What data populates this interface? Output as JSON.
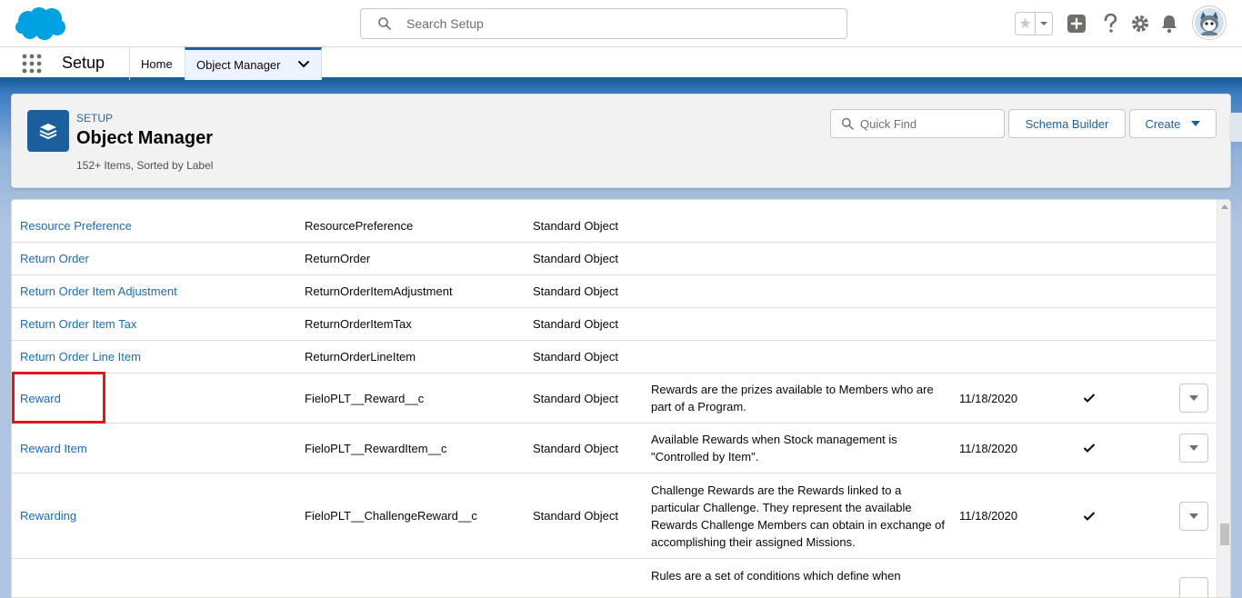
{
  "header": {
    "logo_icon": "salesforce-cloud-logo",
    "search_placeholder": "Search Setup",
    "icons": [
      "favorites-star-icon",
      "favorites-dropdown-icon",
      "global-actions-plus-icon",
      "help-question-icon",
      "setup-gear-icon",
      "notifications-bell-icon",
      "user-avatar"
    ]
  },
  "context_bar": {
    "app_name": "Setup",
    "tabs": [
      {
        "label": "Home"
      },
      {
        "label": "Object Manager"
      }
    ]
  },
  "page_header": {
    "eyebrow": "SETUP",
    "title": "Object Manager",
    "meta": "152+ Items, Sorted by Label",
    "quick_find_placeholder": "Quick Find",
    "schema_builder_label": "Schema Builder",
    "create_label": "Create"
  },
  "rows": [
    {
      "label": "Resource Preference",
      "api": "ResourcePreference",
      "type": "Standard Object",
      "desc": "",
      "date": "",
      "deployed": false
    },
    {
      "label": "Return Order",
      "api": "ReturnOrder",
      "type": "Standard Object",
      "desc": "",
      "date": "",
      "deployed": false
    },
    {
      "label": "Return Order Item Adjustment",
      "api": "ReturnOrderItemAdjustment",
      "type": "Standard Object",
      "desc": "",
      "date": "",
      "deployed": false
    },
    {
      "label": "Return Order Item Tax",
      "api": "ReturnOrderItemTax",
      "type": "Standard Object",
      "desc": "",
      "date": "",
      "deployed": false
    },
    {
      "label": "Return Order Line Item",
      "api": "ReturnOrderLineItem",
      "type": "Standard Object",
      "desc": "",
      "date": "",
      "deployed": false
    },
    {
      "label": "Reward",
      "api": "FieloPLT__Reward__c",
      "type": "Standard Object",
      "desc": "Rewards are the prizes available to Members who are part of a Program.",
      "date": "11/18/2020",
      "deployed": true
    },
    {
      "label": "Reward Item",
      "api": "FieloPLT__RewardItem__c",
      "type": "Standard Object",
      "desc": "Available Rewards when Stock management is \"Controlled by Item\".",
      "date": "11/18/2020",
      "deployed": true
    },
    {
      "label": "Rewarding",
      "api": "FieloPLT__ChallengeReward__c",
      "type": "Standard Object",
      "desc": "Challenge Rewards are the Rewards linked to a particular Challenge. They represent the available Rewards Challenge Members can obtain in exchange of accomplishing their assigned Missions.",
      "date": "11/18/2020",
      "deployed": true
    },
    {
      "label": "",
      "api": "",
      "type": "",
      "desc": "Rules are a set of conditions which define when",
      "date": "",
      "deployed": false
    }
  ],
  "highlight_row_label": "Reward"
}
